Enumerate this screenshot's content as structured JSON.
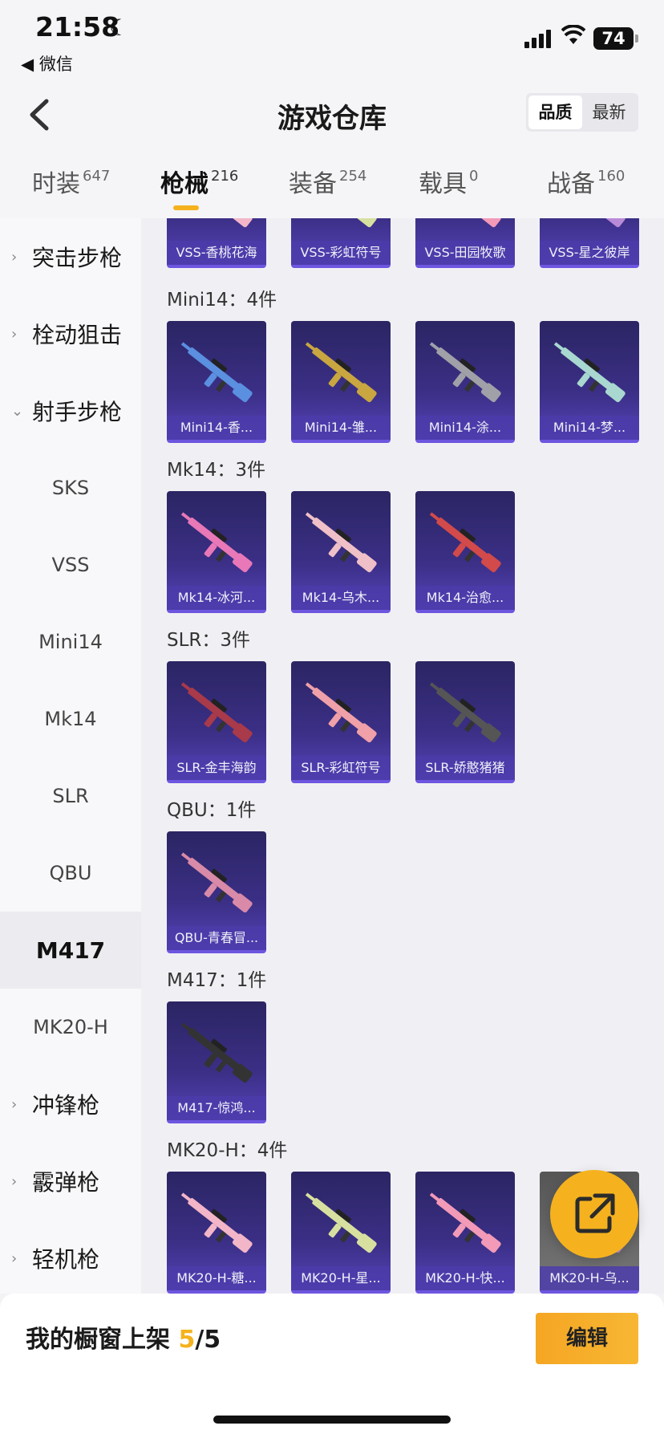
{
  "status_bar": {
    "time": "21:58",
    "back_app": "◀ 微信",
    "battery": "74"
  },
  "header": {
    "title": "游戏仓库",
    "sort": [
      "品质",
      "最新"
    ]
  },
  "tabs": [
    {
      "label": "时装",
      "count": "647"
    },
    {
      "label": "枪械",
      "count": "216"
    },
    {
      "label": "装备",
      "count": "254"
    },
    {
      "label": "载具",
      "count": "0"
    },
    {
      "label": "战备",
      "count": "160"
    }
  ],
  "sidebar": [
    {
      "label": "突击步枪"
    },
    {
      "label": "栓动狙击"
    },
    {
      "label": "射手步枪"
    },
    {
      "label": "SKS"
    },
    {
      "label": "VSS"
    },
    {
      "label": "Mini14"
    },
    {
      "label": "Mk14"
    },
    {
      "label": "SLR"
    },
    {
      "label": "QBU"
    },
    {
      "label": "M417"
    },
    {
      "label": "MK20-H"
    },
    {
      "label": "冲锋枪"
    },
    {
      "label": "霰弹枪"
    },
    {
      "label": "轻机枪"
    }
  ],
  "sections": [
    {
      "title": "",
      "items": [
        "VSS-香桃花海",
        "VSS-彩虹符号",
        "VSS-田园牧歌",
        "VSS-星之彼岸"
      ]
    },
    {
      "title": "Mini14：4件",
      "items": [
        "Mini14-香...",
        "Mini14-雏...",
        "Mini14-涂...",
        "Mini14-梦..."
      ]
    },
    {
      "title": "Mk14：3件",
      "items": [
        "Mk14-冰河...",
        "Mk14-乌木...",
        "Mk14-治愈..."
      ]
    },
    {
      "title": "SLR：3件",
      "items": [
        "SLR-金丰海韵",
        "SLR-彩虹符号",
        "SLR-娇憨猪猪"
      ]
    },
    {
      "title": "QBU：1件",
      "items": [
        "QBU-青春冒..."
      ]
    },
    {
      "title": "M417：1件",
      "items": [
        "M417-惊鸿..."
      ]
    },
    {
      "title": "MK20-H：4件",
      "items": [
        "MK20-H-糖...",
        "MK20-H-星...",
        "MK20-H-快...",
        "MK20-H-乌..."
      ]
    }
  ],
  "bottom": {
    "shelf_label": "我的橱窗上架 ",
    "shelf_current": "5",
    "shelf_total": "/5",
    "edit": "编辑"
  },
  "colors": {
    "accent": "#f5b21e",
    "card_bg": "#3b2f86",
    "card_label": "#4b3caa"
  }
}
